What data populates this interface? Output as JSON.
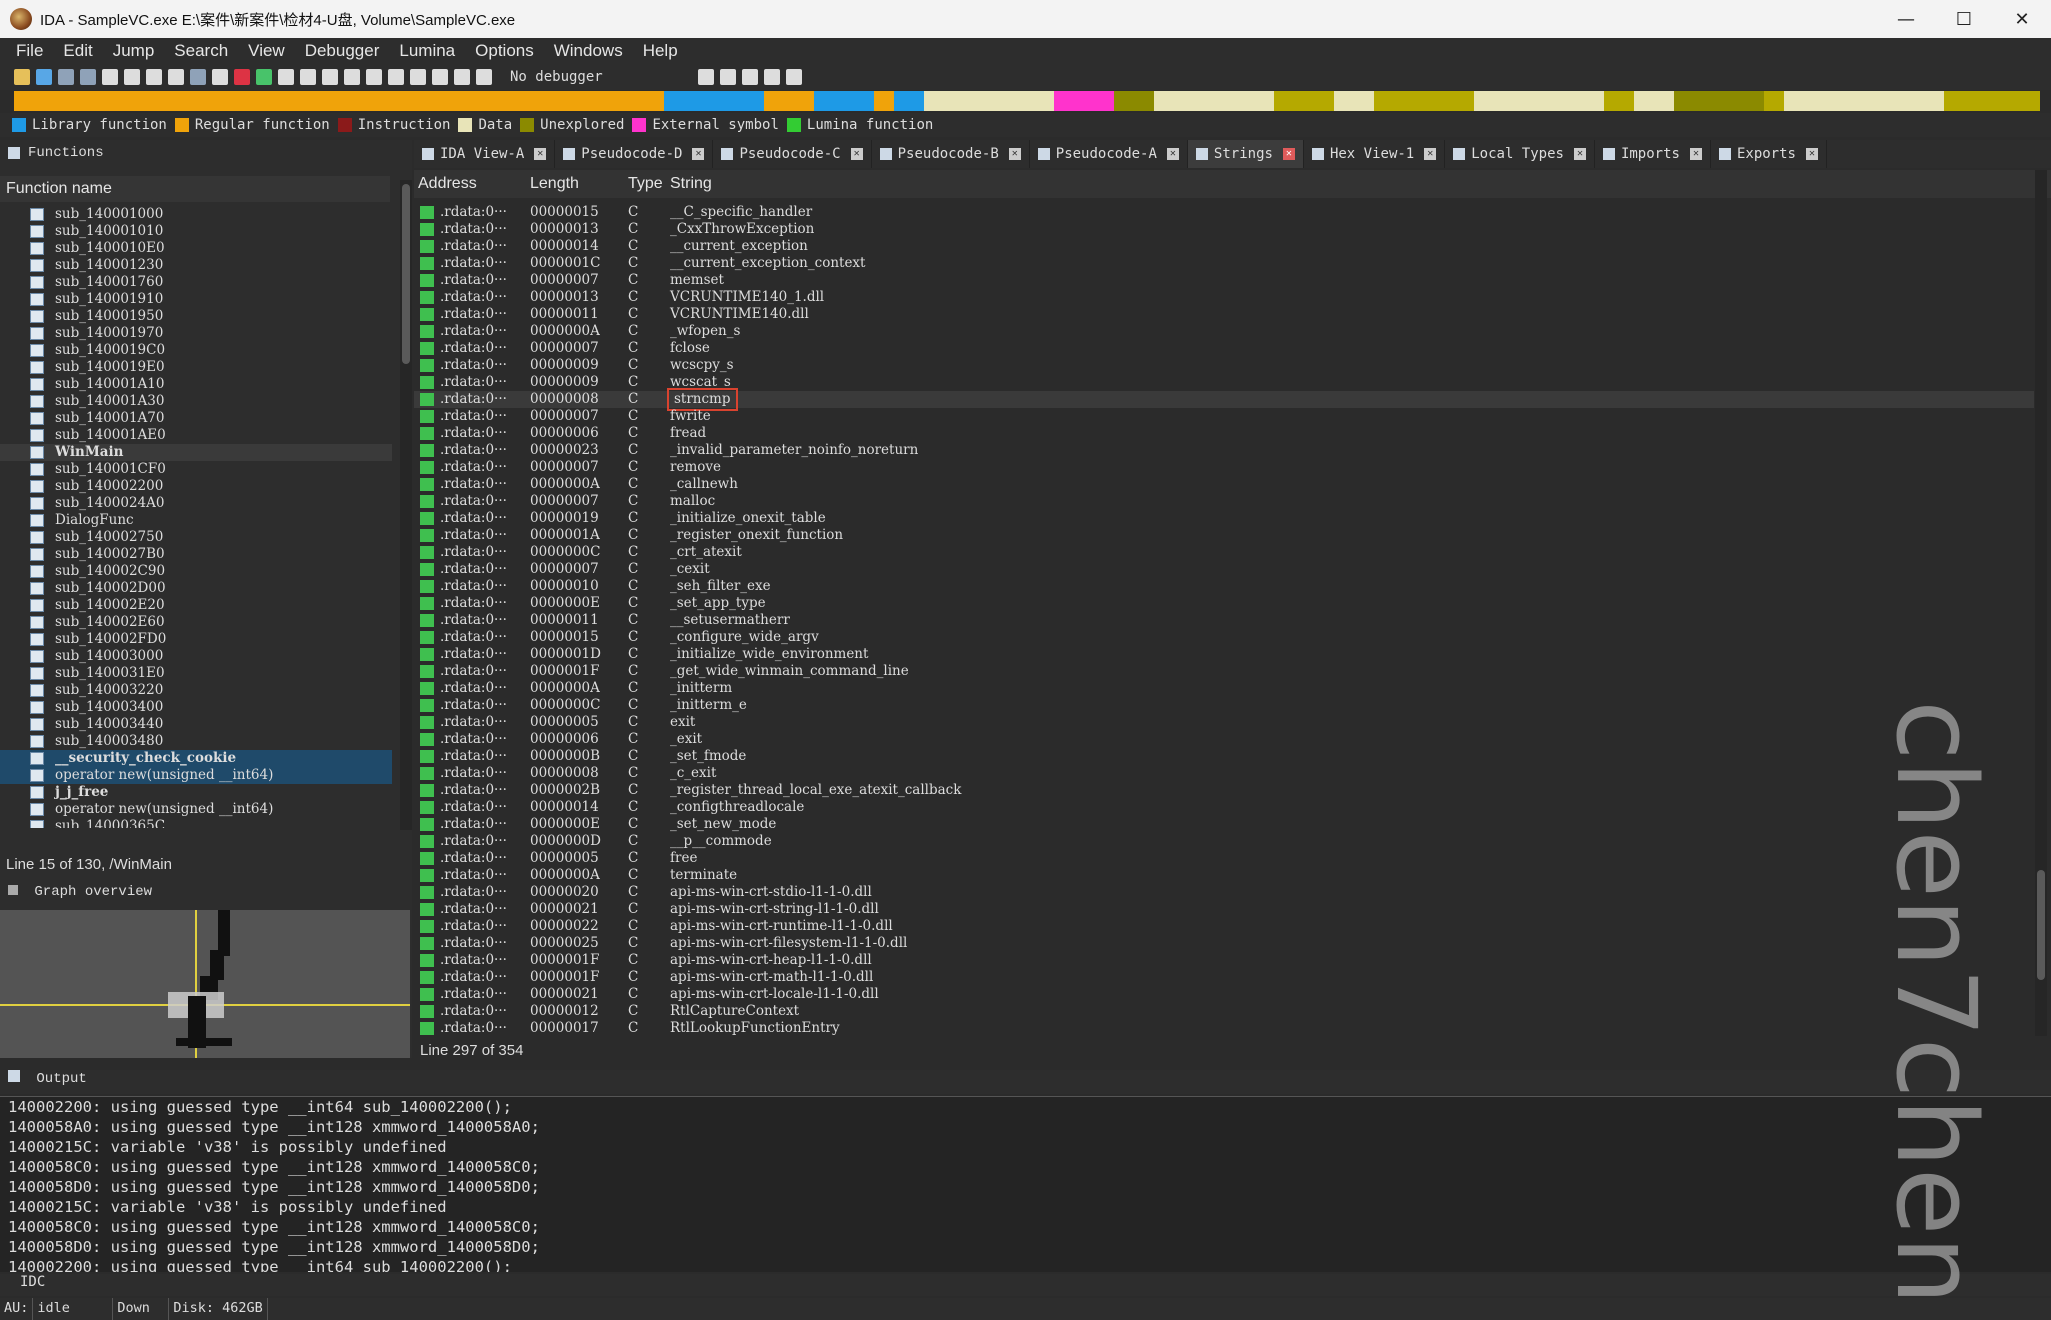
{
  "window": {
    "title": "IDA - SampleVC.exe E:\\案件\\新案件\\检材4-U盘, Volume\\SampleVC.exe",
    "controls": [
      "—",
      "☐",
      "✕"
    ]
  },
  "menu": [
    "File",
    "Edit",
    "Jump",
    "Search",
    "View",
    "Debugger",
    "Lumina",
    "Options",
    "Windows",
    "Help"
  ],
  "toolbar": {
    "debugger": "No debugger"
  },
  "legend": [
    {
      "label": "Library function",
      "color": "#1e9ae6"
    },
    {
      "label": "Regular function",
      "color": "#f0a30a"
    },
    {
      "label": "Instruction",
      "color": "#8b1a1a"
    },
    {
      "label": "Data",
      "color": "#e8e4b8"
    },
    {
      "label": "Unexplored",
      "color": "#8b8a00"
    },
    {
      "label": "External symbol",
      "color": "#ff33cc"
    },
    {
      "label": "Lumina function",
      "color": "#33cc33"
    }
  ],
  "functions": {
    "header": "Functions",
    "column": "Function name",
    "items": [
      "sub_140001000",
      "sub_140001010",
      "sub_1400010E0",
      "sub_140001230",
      "sub_140001760",
      "sub_140001910",
      "sub_140001950",
      "sub_140001970",
      "sub_1400019C0",
      "sub_1400019E0",
      "sub_140001A10",
      "sub_140001A30",
      "sub_140001A70",
      "sub_140001AE0",
      "WinMain",
      "sub_140001CF0",
      "sub_140002200",
      "sub_1400024A0",
      "DialogFunc",
      "sub_140002750",
      "sub_1400027B0",
      "sub_140002C90",
      "sub_140002D00",
      "sub_140002E20",
      "sub_140002E60",
      "sub_140002FD0",
      "sub_140003000",
      "sub_1400031E0",
      "sub_140003220",
      "sub_140003400",
      "sub_140003440",
      "sub_140003480",
      "__security_check_cookie",
      "operator new(unsigned __int64)",
      "j_j_free",
      "operator new(unsigned __int64)",
      "sub_14000365C"
    ],
    "line_status": "Line 15 of 130, /WinMain"
  },
  "graph": {
    "header": "Graph overview"
  },
  "tabs": [
    "IDA View-A",
    "Pseudocode-D",
    "Pseudocode-C",
    "Pseudocode-B",
    "Pseudocode-A",
    "Strings",
    "Hex View-1",
    "Local Types",
    "Imports",
    "Exports"
  ],
  "strings": {
    "columns": [
      "Address",
      "Length",
      "Type",
      "String"
    ],
    "rows": [
      [
        ".rdata:0···",
        "00000015",
        "C",
        "__C_specific_handler"
      ],
      [
        ".rdata:0···",
        "00000013",
        "C",
        "_CxxThrowException"
      ],
      [
        ".rdata:0···",
        "00000014",
        "C",
        "__current_exception"
      ],
      [
        ".rdata:0···",
        "0000001C",
        "C",
        "__current_exception_context"
      ],
      [
        ".rdata:0···",
        "00000007",
        "C",
        "memset"
      ],
      [
        ".rdata:0···",
        "00000013",
        "C",
        "VCRUNTIME140_1.dll"
      ],
      [
        ".rdata:0···",
        "00000011",
        "C",
        "VCRUNTIME140.dll"
      ],
      [
        ".rdata:0···",
        "0000000A",
        "C",
        "_wfopen_s"
      ],
      [
        ".rdata:0···",
        "00000007",
        "C",
        "fclose"
      ],
      [
        ".rdata:0···",
        "00000009",
        "C",
        "wcscpy_s"
      ],
      [
        ".rdata:0···",
        "00000009",
        "C",
        "wcscat_s"
      ],
      [
        ".rdata:0···",
        "00000008",
        "C",
        "strncmp"
      ],
      [
        ".rdata:0···",
        "00000007",
        "C",
        "fwrite"
      ],
      [
        ".rdata:0···",
        "00000006",
        "C",
        "fread"
      ],
      [
        ".rdata:0···",
        "00000023",
        "C",
        "_invalid_parameter_noinfo_noreturn"
      ],
      [
        ".rdata:0···",
        "00000007",
        "C",
        "remove"
      ],
      [
        ".rdata:0···",
        "0000000A",
        "C",
        "_callnewh"
      ],
      [
        ".rdata:0···",
        "00000007",
        "C",
        "malloc"
      ],
      [
        ".rdata:0···",
        "00000019",
        "C",
        "_initialize_onexit_table"
      ],
      [
        ".rdata:0···",
        "0000001A",
        "C",
        "_register_onexit_function"
      ],
      [
        ".rdata:0···",
        "0000000C",
        "C",
        "_crt_atexit"
      ],
      [
        ".rdata:0···",
        "00000007",
        "C",
        "_cexit"
      ],
      [
        ".rdata:0···",
        "00000010",
        "C",
        "_seh_filter_exe"
      ],
      [
        ".rdata:0···",
        "0000000E",
        "C",
        "_set_app_type"
      ],
      [
        ".rdata:0···",
        "00000011",
        "C",
        "__setusermatherr"
      ],
      [
        ".rdata:0···",
        "00000015",
        "C",
        "_configure_wide_argv"
      ],
      [
        ".rdata:0···",
        "0000001D",
        "C",
        "_initialize_wide_environment"
      ],
      [
        ".rdata:0···",
        "0000001F",
        "C",
        "_get_wide_winmain_command_line"
      ],
      [
        ".rdata:0···",
        "0000000A",
        "C",
        "_initterm"
      ],
      [
        ".rdata:0···",
        "0000000C",
        "C",
        "_initterm_e"
      ],
      [
        ".rdata:0···",
        "00000005",
        "C",
        "exit"
      ],
      [
        ".rdata:0···",
        "00000006",
        "C",
        "_exit"
      ],
      [
        ".rdata:0···",
        "0000000B",
        "C",
        "_set_fmode"
      ],
      [
        ".rdata:0···",
        "00000008",
        "C",
        "_c_exit"
      ],
      [
        ".rdata:0···",
        "0000002B",
        "C",
        "_register_thread_local_exe_atexit_callback"
      ],
      [
        ".rdata:0···",
        "00000014",
        "C",
        "_configthreadlocale"
      ],
      [
        ".rdata:0···",
        "0000000E",
        "C",
        "_set_new_mode"
      ],
      [
        ".rdata:0···",
        "0000000D",
        "C",
        "__p__commode"
      ],
      [
        ".rdata:0···",
        "00000005",
        "C",
        "free"
      ],
      [
        ".rdata:0···",
        "0000000A",
        "C",
        "terminate"
      ],
      [
        ".rdata:0···",
        "00000020",
        "C",
        "api-ms-win-crt-stdio-l1-1-0.dll"
      ],
      [
        ".rdata:0···",
        "00000021",
        "C",
        "api-ms-win-crt-string-l1-1-0.dll"
      ],
      [
        ".rdata:0···",
        "00000022",
        "C",
        "api-ms-win-crt-runtime-l1-1-0.dll"
      ],
      [
        ".rdata:0···",
        "00000025",
        "C",
        "api-ms-win-crt-filesystem-l1-1-0.dll"
      ],
      [
        ".rdata:0···",
        "0000001F",
        "C",
        "api-ms-win-crt-heap-l1-1-0.dll"
      ],
      [
        ".rdata:0···",
        "0000001F",
        "C",
        "api-ms-win-crt-math-l1-1-0.dll"
      ],
      [
        ".rdata:0···",
        "00000021",
        "C",
        "api-ms-win-crt-locale-l1-1-0.dll"
      ],
      [
        ".rdata:0···",
        "00000012",
        "C",
        "RtlCaptureContext"
      ],
      [
        ".rdata:0···",
        "00000017",
        "C",
        "RtlLookupFunctionEntry"
      ]
    ],
    "line_status": "Line 297 of 354"
  },
  "output": {
    "header": "Output",
    "lines": [
      "140002200: using guessed type __int64 sub_140002200();",
      "1400058A0: using guessed type __int128 xmmword_1400058A0;",
      "14000215C: variable 'v38' is possibly undefined",
      "1400058C0: using guessed type __int128 xmmword_1400058C0;",
      "1400058D0: using guessed type __int128 xmmword_1400058D0;",
      "14000215C: variable 'v38' is possibly undefined",
      "1400058C0: using guessed type __int128 xmmword_1400058C0;",
      "1400058D0: using guessed type __int128 xmmword_1400058D0;",
      "140002200: using guessed type __int64 sub_140002200();"
    ]
  },
  "idc": "IDC",
  "status": {
    "au": "AU:",
    "state": "idle",
    "dir": "Down",
    "disk": "Disk: 462GB"
  },
  "watermark": "chen7chen"
}
